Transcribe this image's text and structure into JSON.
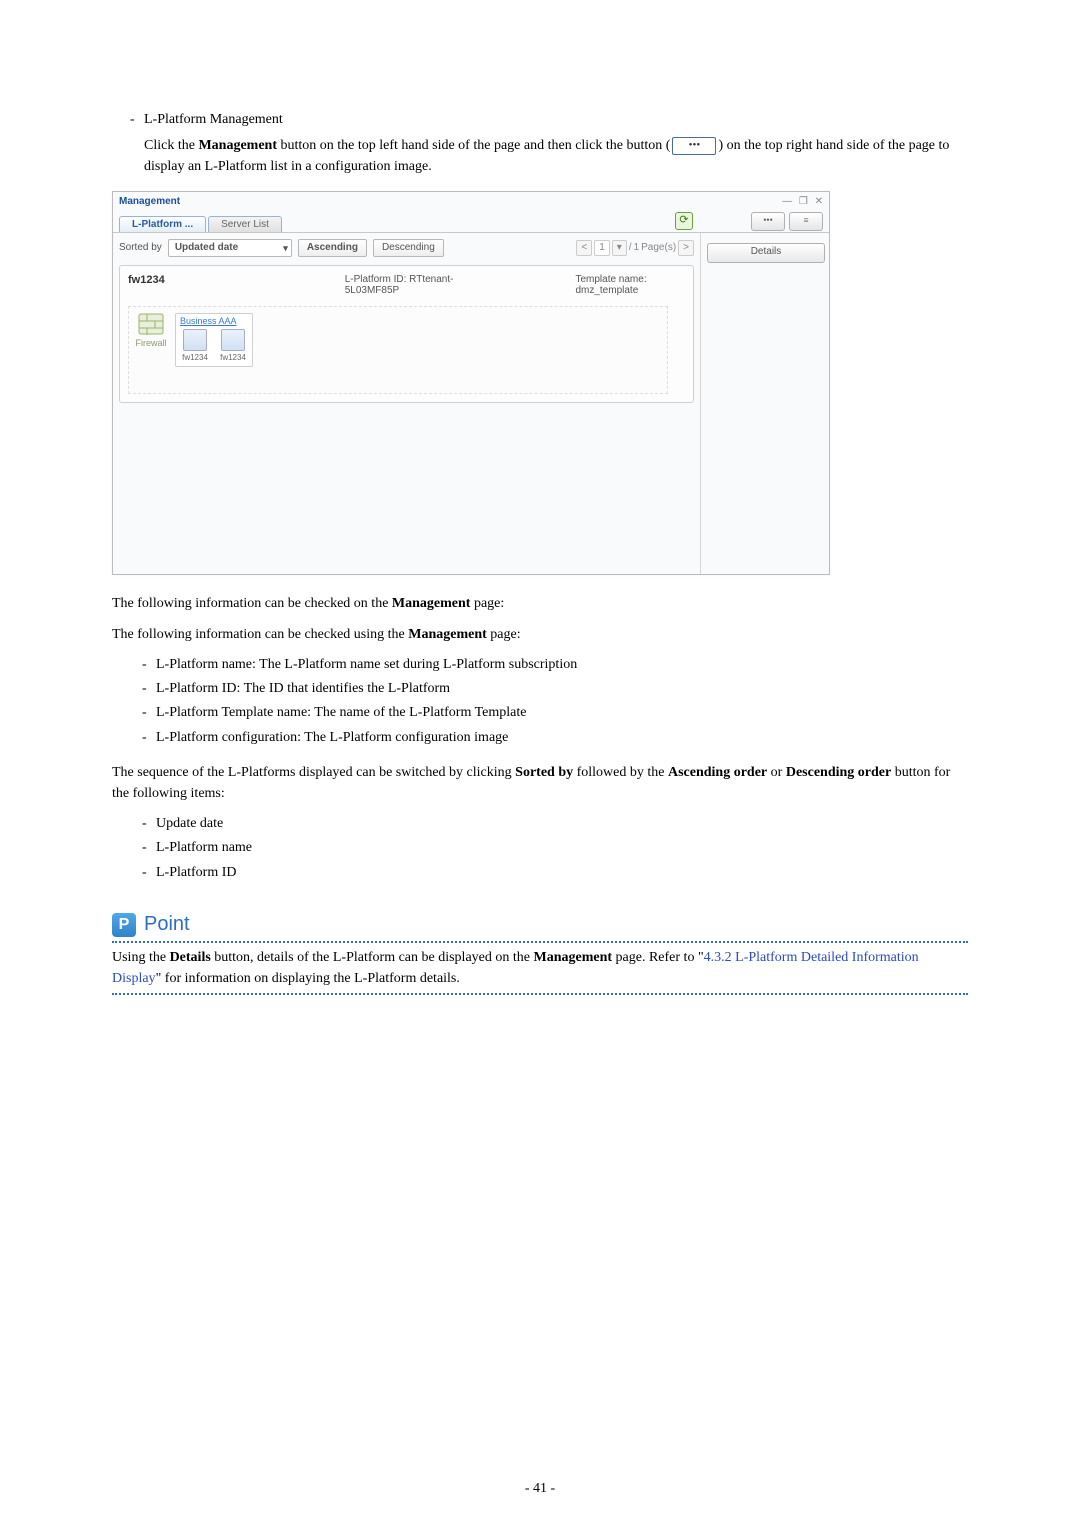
{
  "doc": {
    "section_title": "L-Platform Management",
    "intro_a": "Click the ",
    "intro_b": " button on the top left hand side of the page and then click the button (",
    "intro_c": ") on the top right hand side of the page to display an L-Platform list in a configuration image.",
    "mgmt_bold": "Management",
    "inline_button_dots": "•••",
    "after_shot_1a": "The following information can be checked on the ",
    "after_shot_1b": " page:",
    "after_shot_2a": "The following information can be checked using the ",
    "after_shot_2b": " page:",
    "info_items": {
      "a": "L-Platform name: The L-Platform name set during L-Platform subscription",
      "b": "L-Platform ID: The ID that identifies the L-Platform",
      "c": "L-Platform Template name: The name of the L-Platform Template",
      "d": "L-Platform configuration: The L-Platform configuration image"
    },
    "seq_a": "The sequence of the L-Platforms displayed can be switched by clicking ",
    "seq_sorted": "Sorted by",
    "seq_b": " followed by the ",
    "seq_asc": "Ascending order",
    "seq_c": " or ",
    "seq_desc": "Descending order",
    "seq_d": " button for the following items:",
    "sort_items": {
      "a": "Update date",
      "b": "L-Platform name",
      "c": "L-Platform ID"
    },
    "point_label": "Point",
    "point_a": "Using the ",
    "point_details": "Details",
    "point_b": " button, details of the L-Platform can be displayed on the ",
    "point_c": " page. Refer to \"",
    "point_link": "4.3.2 L-Platform Detailed Information Display",
    "point_d": "\" for information on displaying the L-Platform details.",
    "page_number": "- 41 -"
  },
  "app": {
    "title": "Management",
    "tabs": {
      "active": "L-Platform ...",
      "inactive": "Server List"
    },
    "sorted_label": "Sorted by",
    "sort_field": "Updated date",
    "asc": "Ascending",
    "desc": "Descending",
    "pager": {
      "prev": "<",
      "cur": "1",
      "dd": "▾",
      "sep": "/",
      "total": "1",
      "pages": "Page(s)",
      "next": ">"
    },
    "details": "Details",
    "dots": "•••",
    "list_icon": "≡",
    "card": {
      "name": "fw1234",
      "id_label": "L-Platform ID:",
      "id_value": "RTtenant-5L03MF85P",
      "tpl_label": "Template name:",
      "tpl_value": "dmz_template",
      "segment": "Business AAA",
      "fw_label": "Firewall",
      "node1": "fw1234",
      "node2": "fw1234"
    }
  }
}
